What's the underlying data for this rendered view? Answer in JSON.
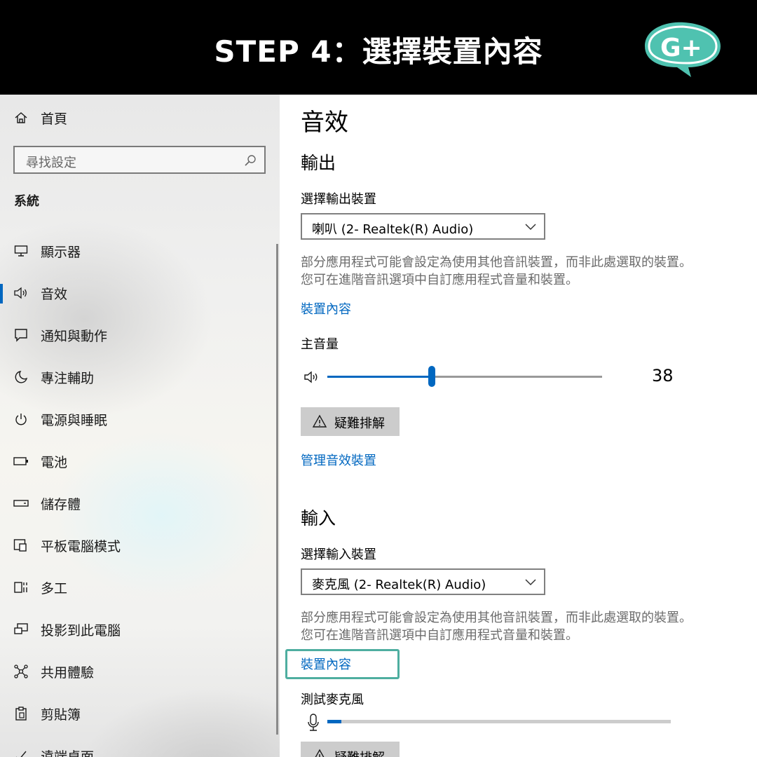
{
  "banner": {
    "title": "STEP 4：選擇裝置內容",
    "logo_text": "G+"
  },
  "sidebar": {
    "home_label": "首頁",
    "search_placeholder": "尋找設定",
    "section_label": "系統",
    "items": [
      {
        "label": "顯示器",
        "icon": "monitor-icon"
      },
      {
        "label": "音效",
        "icon": "speaker-icon",
        "active": true
      },
      {
        "label": "通知與動作",
        "icon": "notification-icon"
      },
      {
        "label": "專注輔助",
        "icon": "moon-icon"
      },
      {
        "label": "電源與睡眠",
        "icon": "power-icon"
      },
      {
        "label": "電池",
        "icon": "battery-icon"
      },
      {
        "label": "儲存體",
        "icon": "storage-icon"
      },
      {
        "label": "平板電腦模式",
        "icon": "tablet-icon"
      },
      {
        "label": "多工",
        "icon": "multitask-icon"
      },
      {
        "label": "投影到此電腦",
        "icon": "project-icon"
      },
      {
        "label": "共用體驗",
        "icon": "share-icon"
      },
      {
        "label": "剪貼簿",
        "icon": "clipboard-icon"
      },
      {
        "label": "遠端桌面",
        "icon": "remote-desktop-icon"
      }
    ]
  },
  "content": {
    "title": "音效",
    "output": {
      "heading": "輸出",
      "select_label": "選擇輸出裝置",
      "selected_device": "喇叭 (2- Realtek(R) Audio)",
      "description": "部分應用程式可能會設定為使用其他音訊裝置，而非此處選取的裝置。您可在進階音訊選項中自訂應用程式音量和裝置。",
      "properties_link": "裝置內容",
      "volume_label": "主音量",
      "volume_value": "38",
      "volume_fraction": 0.38,
      "troubleshoot_label": "疑難排解",
      "manage_link": "管理音效裝置"
    },
    "input": {
      "heading": "輸入",
      "select_label": "選擇輸入裝置",
      "selected_device": "麥克風 (2- Realtek(R) Audio)",
      "description": "部分應用程式可能會設定為使用其他音訊裝置，而非此處選取的裝置。您可在進階音訊選項中自訂應用程式音量和裝置。",
      "properties_link": "裝置內容",
      "test_label": "測試麥克風",
      "mic_level_fraction": 0.04,
      "troubleshoot_label": "疑難排解"
    }
  },
  "colors": {
    "accent": "#0067c0",
    "highlight": "#4eaea0",
    "banner_bg": "#000000"
  }
}
